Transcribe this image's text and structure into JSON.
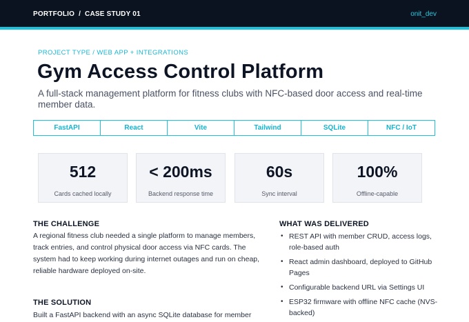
{
  "header": {
    "breadcrumb": "PORTFOLIO  /  CASE STUDY 01",
    "username": "onit_dev"
  },
  "hero": {
    "eyebrow": "PROJECT TYPE / WEB APP + INTEGRATIONS",
    "title": "Gym Access Control Platform",
    "subtitle": "A full-stack management platform for fitness clubs with NFC-based door access and real-time member data."
  },
  "tags": [
    "FastAPI",
    "React",
    "Vite",
    "Tailwind",
    "SQLite",
    "NFC / IoT"
  ],
  "stats": [
    {
      "value": "512",
      "label": "Cards cached locally"
    },
    {
      "value": "< 200ms",
      "label": "Backend response time"
    },
    {
      "value": "60s",
      "label": "Sync interval"
    },
    {
      "value": "100%",
      "label": "Offline-capable"
    }
  ],
  "challenge": {
    "heading": "THE CHALLENGE",
    "body": "A regional fitness club needed a single platform to manage members, track entries, and control physical door access via NFC cards. The system had to keep working during internet outages and run on cheap, reliable hardware deployed on-site."
  },
  "solution": {
    "heading": "THE SOLUTION",
    "body": "Built a FastAPI backend with an async SQLite database for member"
  },
  "delivered": {
    "heading": "WHAT WAS DELIVERED",
    "items": [
      "REST API with member CRUD, access logs, role-based auth",
      "React admin dashboard, deployed to GitHub Pages",
      "Configurable backend URL via Settings UI",
      "ESP32 firmware with offline NFC cache (NVS-backed)"
    ]
  },
  "colors": {
    "topbar": "#0b1220",
    "accent": "#19c3dc",
    "card_bg": "#f3f4f8"
  }
}
